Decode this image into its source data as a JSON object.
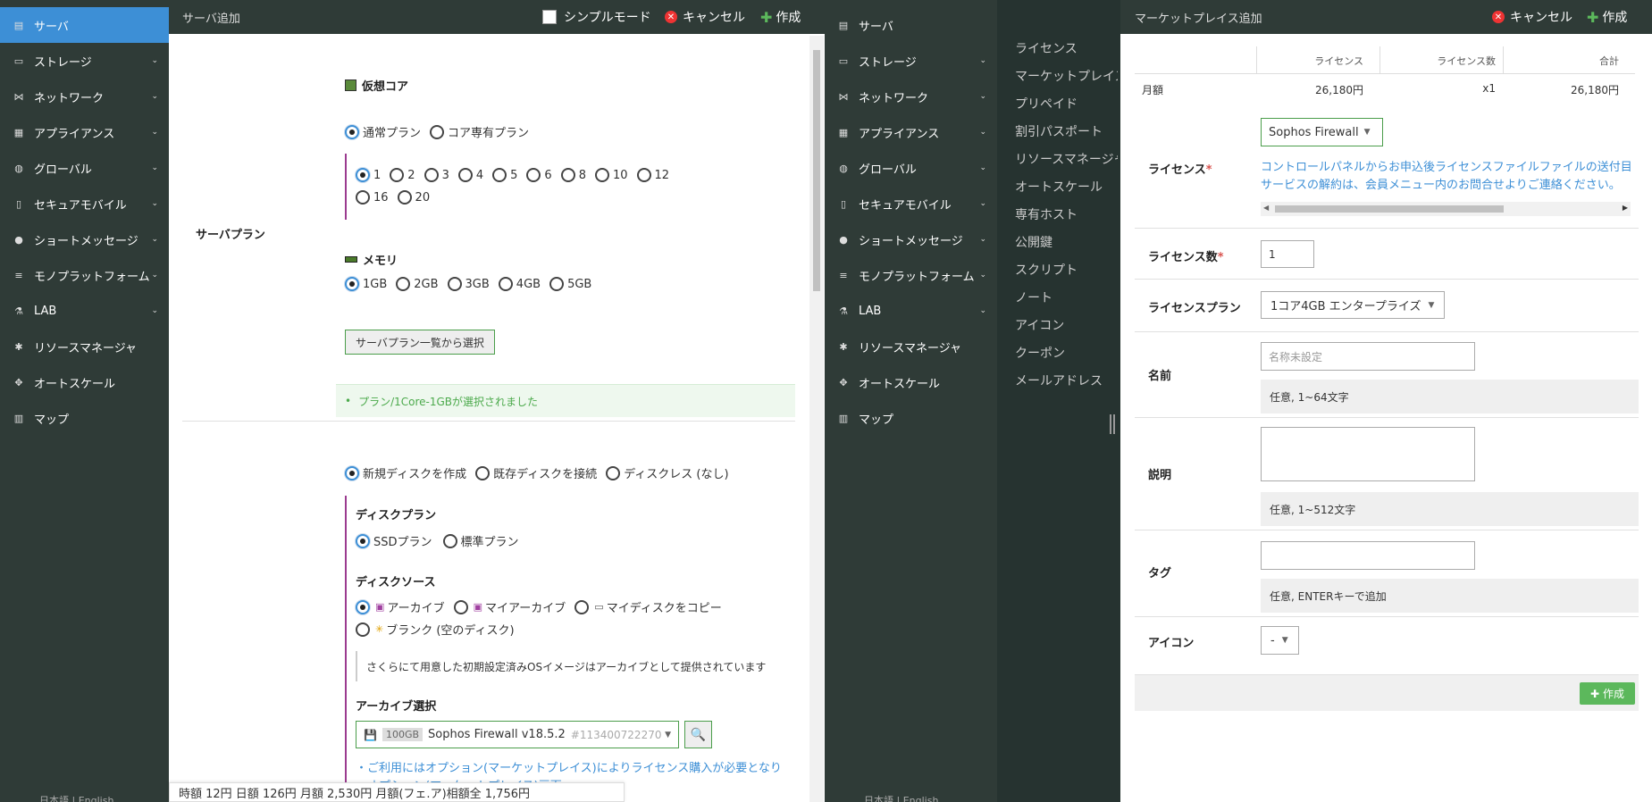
{
  "left_nav": {
    "items": [
      {
        "label": "サーバ",
        "icon": "server-icon",
        "chev": false,
        "active": true
      },
      {
        "label": "ストレージ",
        "icon": "storage-icon",
        "chev": true
      },
      {
        "label": "ネットワーク",
        "icon": "network-icon",
        "chev": true
      },
      {
        "label": "アプライアンス",
        "icon": "appliance-icon",
        "chev": true
      },
      {
        "label": "グローバル",
        "icon": "globe-icon",
        "chev": true
      },
      {
        "label": "セキュアモバイル",
        "icon": "mobile-icon",
        "chev": true
      },
      {
        "label": "ショートメッセージ",
        "icon": "message-icon",
        "chev": true
      },
      {
        "label": "モノプラットフォーム",
        "icon": "platform-icon",
        "chev": true
      },
      {
        "label": "LAB",
        "icon": "flask-icon",
        "chev": true
      },
      {
        "label": "リソースマネージャ",
        "icon": "puzzle-icon",
        "chev": false
      },
      {
        "label": "オートスケール",
        "icon": "arrows-icon",
        "chev": false
      },
      {
        "label": "マップ",
        "icon": "map-icon",
        "chev": false
      }
    ]
  },
  "server_panel": {
    "title": "サーバ追加",
    "simple_mode": "シンプルモード",
    "cancel": "キャンセル",
    "create": "作成",
    "plan_label": "サーバプラン",
    "core_title": "仮想コア",
    "plan_types": [
      "通常プラン",
      "コア専有プラン"
    ],
    "cores": [
      "1",
      "2",
      "3",
      "4",
      "5",
      "6",
      "8",
      "10",
      "12",
      "16",
      "20"
    ],
    "memory_title": "メモリ",
    "memory": [
      "1GB",
      "2GB",
      "3GB",
      "4GB",
      "5GB"
    ],
    "plan_list_button": "サーバプラン一覧から選択",
    "plan_selected_msg": "プラン/1Core-1GBが選択されました",
    "disk_options": [
      "新規ディスクを作成",
      "既存ディスクを接続",
      "ディスクレス (なし)"
    ],
    "disk_plan_title": "ディスクプラン",
    "disk_plans": [
      "SSDプラン",
      "標準プラン"
    ],
    "disk_source_title": "ディスクソース",
    "disk_sources": [
      "アーカイブ",
      "マイアーカイブ",
      "マイディスクをコピー",
      "ブランク (空のディスク)"
    ],
    "archive_note": "さくらにて用意した初期設定済みOSイメージはアーカイブとして提供されています",
    "archive_select_title": "アーカイブ選択",
    "archive_size": "100GB",
    "archive_name": "Sophos Firewall v18.5.2",
    "archive_id": "#113400722270",
    "link_line1": "・ご利用にはオプション(マーケットプレイス)によりライセンス購入が必要となり",
    "link_line2": "　オプション(マーケットプレイス)画面",
    "footer_text": "時額 12円  日額 126円  月額 2,530円  月額(フェ.ア)相額全 1,756円",
    "lang_text": "日本語 | English"
  },
  "middle_nav": {
    "sub_items": [
      "ライセンス",
      "マーケットプレイス",
      "プリペイド",
      "割引パスポート",
      "リソースマネージャ",
      "オートスケール",
      "専有ホスト",
      "公開鍵",
      "スクリプト",
      "ノート",
      "アイコン",
      "クーポン",
      "メールアドレス"
    ]
  },
  "market_panel": {
    "title": "マーケットプレイス追加",
    "cancel": "キャンセル",
    "create": "作成",
    "price_headers": [
      "ライセンス",
      "ライセンス数",
      "合計"
    ],
    "monthly_label": "月額",
    "monthly_values": [
      "26,180円",
      "x1",
      "26,180円"
    ],
    "license_label": "ライセンス",
    "license_value": "Sophos Firewall",
    "license_info_1": "コントロールパネルからお申込後ライセンスファイルファイルの送付目",
    "license_info_2": "サービスの解約は、会員メニュー内のお問合せよりご連絡ください。",
    "license_count_label": "ライセンス数",
    "license_count_value": "1",
    "license_plan_label": "ライセンスプラン",
    "license_plan_value": "1コア4GB エンタープライズ",
    "name_label": "名前",
    "name_placeholder": "名称未設定",
    "name_hint": "任意, 1~64文字",
    "desc_label": "説明",
    "desc_hint": "任意, 1~512文字",
    "tag_label": "タグ",
    "tag_hint": "任意, ENTERキーで追加",
    "icon_label": "アイコン",
    "icon_value": "-",
    "create_button": "作成"
  }
}
